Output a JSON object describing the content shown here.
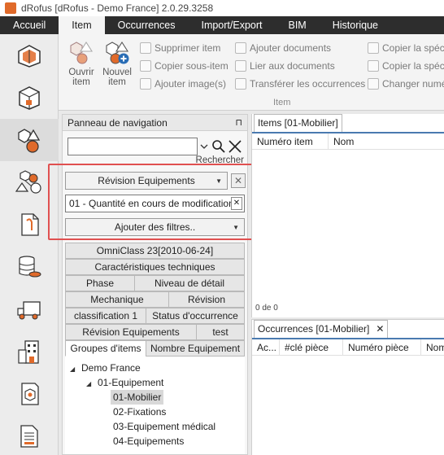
{
  "window": {
    "title": "dRofus [dRofus - Demo France] 2.0.29.3258"
  },
  "menu": {
    "items": [
      "Accueil",
      "Item",
      "Occurrences",
      "Import/Export",
      "BIM",
      "Historique"
    ]
  },
  "ribbon": {
    "open_item": "Ouvrir item",
    "new_item": "Nouvel item",
    "col1": [
      "Supprimer item",
      "Copier sous-item",
      "Ajouter image(s)"
    ],
    "col2": [
      "Ajouter documents",
      "Lier aux documents",
      "Transférer les occurrences"
    ],
    "col3": [
      "Copier la spéci",
      "Copier la spéci",
      "Changer numé"
    ],
    "group_label": "Item"
  },
  "sidebar": {
    "icons": [
      "rooms-icon",
      "room-3d-icon",
      "items-icon",
      "occurrences-icon",
      "documents-icon",
      "database-icon",
      "logistics-icon",
      "buildings-icon",
      "package-icon",
      "reports-icon"
    ],
    "active_index": 2
  },
  "nav_panel": {
    "title": "Panneau de navigation",
    "pin": "⊓",
    "search_value": "",
    "search_button": "Rechercher",
    "filter1": "Révision Equipements",
    "filter2": "01 - Quantité en cours de modification",
    "add_filters": "Ajouter des filtres..",
    "tab_rows": [
      [
        "OmniClass 23[2010-06-24]"
      ],
      [
        "Caractéristiques techniques"
      ],
      [
        "Phase",
        "Niveau de détail"
      ],
      [
        "Mechanique",
        "Révision"
      ],
      [
        "classification 1",
        "Status d'occurrence"
      ],
      [
        "Révision Equipements",
        "test"
      ],
      [
        "Groupes d'items",
        "Nombre Equipement"
      ]
    ],
    "tree": [
      "Demo France",
      "01-Equipement",
      "01-Mobilier",
      "02-Fixations",
      "03-Equipement médical",
      "04-Equipements"
    ]
  },
  "items_panel": {
    "tab": "Items [01-Mobilier]",
    "columns": [
      "Numéro item",
      "Nom"
    ],
    "count": "0 de 0"
  },
  "occurrences_panel": {
    "tab": "Occurrences [01-Mobilier]",
    "close": "✕",
    "columns": [
      "Ac...",
      "#clé pièce",
      "Numéro pièce",
      "Nom"
    ]
  },
  "colors": {
    "menubar": "#2d2d2d",
    "accent_orange": "#e06a2a",
    "highlight_red": "#e05050",
    "tab_underline": "#4a7ab0"
  }
}
